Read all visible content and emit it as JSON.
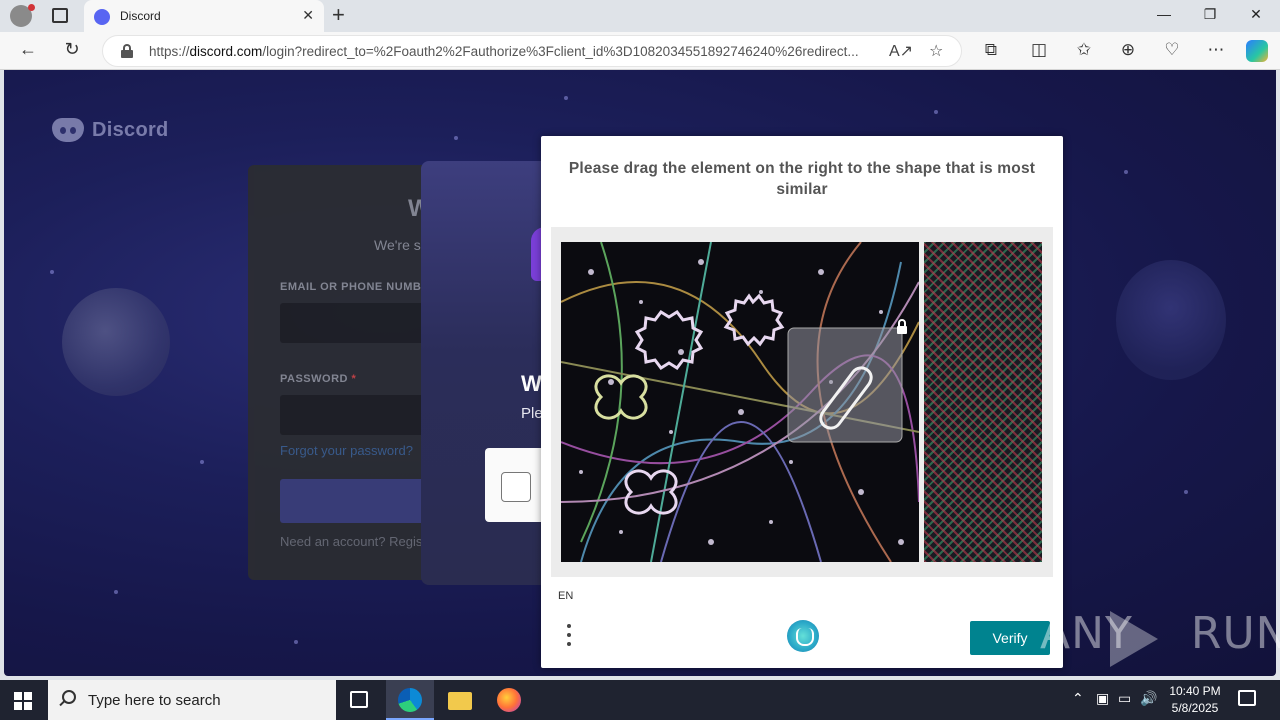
{
  "browser": {
    "tab_title": "Discord",
    "url_prefix": "https://",
    "url_domain": "discord.com",
    "url_rest": "/login?redirect_to=%2Foauth2%2Fauthorize%3Fclient_id%3D1082034551892746240%26redirect...",
    "window_controls": {
      "minimize": "—",
      "restore": "❐",
      "close": "✕"
    }
  },
  "page": {
    "brand": "Discord",
    "login": {
      "welcome": "W",
      "subtitle": "We're s",
      "email_label": "EMAIL OR PHONE NUMBE",
      "password_label": "PASSWORD",
      "required_mark": "*",
      "forgot": "Forgot your password?",
      "need_account": "Need an account? Regis"
    },
    "modal": {
      "heading": "W",
      "text": "Ple"
    }
  },
  "captcha": {
    "prompt": "Please drag the element on the right to the shape that is most similar",
    "language": "EN",
    "verify_label": "Verify",
    "accent": "#00838f"
  },
  "watermark": {
    "text": "ANY",
    "text2": "RUN"
  },
  "taskbar": {
    "search_placeholder": "Type here to search",
    "time": "10:40 PM",
    "date": "5/8/2025"
  }
}
